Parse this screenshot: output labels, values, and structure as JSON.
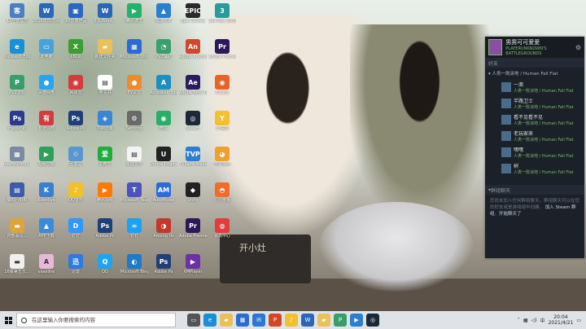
{
  "desktop_icons": [
    {
      "label": "13号管理员",
      "color": "#4c7fc1",
      "glyph": "客"
    },
    {
      "label": "Microsoft Edge",
      "color": "#1b8fd6",
      "glyph": "e"
    },
    {
      "label": "PVZ游戏",
      "color": "#3a9e6a",
      "glyph": "P"
    },
    {
      "label": "magic_in",
      "color": "#2b3a8f",
      "glyph": "Ps"
    },
    {
      "label": "img_d9f4f8...jpg",
      "color": "#7a8aa0",
      "glyph": "▦"
    },
    {
      "label": "编织行5(8)",
      "color": "#3e5aa8",
      "glyph": "▤"
    },
    {
      "label": "内部会议...",
      "color": "#d9a53c",
      "glyph": "▬"
    },
    {
      "label": "16级第五次...",
      "color": "#f0f0f0",
      "glyph": "▬"
    },
    {
      "label": "2018年日记.docx",
      "color": "#2b66b8",
      "glyph": "W"
    },
    {
      "label": "此电脑",
      "color": "#4aa0d9",
      "glyph": "▭"
    },
    {
      "label": "百度网盘",
      "color": "#2ba3f3",
      "glyph": "●"
    },
    {
      "label": "有道词典",
      "color": "#d23c3c",
      "glyph": "有"
    },
    {
      "label": "视频剪辑",
      "color": "#2ea05a",
      "glyph": "▶"
    },
    {
      "label": "Kdenlive",
      "color": "#3a7fd0",
      "glyph": "K"
    },
    {
      "label": "APP下载",
      "color": "#3b8bd8",
      "glyph": "▲"
    },
    {
      "label": "vaseline",
      "color": "#e7b9d8",
      "glyph": "A"
    },
    {
      "label": "3D创意作品",
      "color": "#2a67c0",
      "glyph": "▣"
    },
    {
      "label": "XBOX",
      "color": "#3e9c35",
      "glyph": "X"
    },
    {
      "label": "网易云",
      "color": "#d93a3a",
      "glyph": "◉"
    },
    {
      "label": "Adobe Ps",
      "color": "#1e3f78",
      "glyph": "Ps"
    },
    {
      "label": "回收站",
      "color": "#5a96d2",
      "glyph": "♲"
    },
    {
      "label": "QQ音乐",
      "color": "#f2c02b",
      "glyph": "♪"
    },
    {
      "label": "钉钉",
      "color": "#3296fa",
      "glyph": "D"
    },
    {
      "label": "迅雷",
      "color": "#2d7ae5",
      "glyph": "迅"
    },
    {
      "label": "1.1.Word...",
      "color": "#2b66b8",
      "glyph": "W"
    },
    {
      "label": "新建文件夹",
      "color": "#e8c15a",
      "glyph": "▰"
    },
    {
      "label": "电子书",
      "color": "#ffffff",
      "glyph": "▤"
    },
    {
      "label": "控制面板",
      "color": "#3a86d2",
      "glyph": "◈"
    },
    {
      "label": "爱奇艺",
      "color": "#1fae3c",
      "glyph": "爱"
    },
    {
      "label": "腾讯视频",
      "color": "#ff7a00",
      "glyph": "▶"
    },
    {
      "label": "Adobe Ps",
      "color": "#1e3f78",
      "glyph": "Ps"
    },
    {
      "label": "QQ",
      "color": "#1fa4f0",
      "glyph": "Q"
    },
    {
      "label": "腾讯课堂",
      "color": "#23b26d",
      "glyph": "▶"
    },
    {
      "label": "Microsoft Store",
      "color": "#2b6cd4",
      "glyph": "▦"
    },
    {
      "label": "EV录屏",
      "color": "#f08a2c",
      "glyph": "●"
    },
    {
      "label": "Settings",
      "color": "#6a6a6a",
      "glyph": "⚙"
    },
    {
      "label": "桌面文件",
      "color": "#f4f4f4",
      "glyph": "▤"
    },
    {
      "label": "Microsoft Teams",
      "color": "#4b53bc",
      "glyph": "T"
    },
    {
      "label": "钉钉",
      "color": "#1da1f2",
      "glyph": "∞"
    },
    {
      "label": "Microsoft Bing",
      "color": "#1d7ac9",
      "glyph": "◐"
    },
    {
      "label": "极速PDF",
      "color": "#2a7fd2",
      "glyph": "▲"
    },
    {
      "label": "PVZ辅助",
      "color": "#3aa06a",
      "glyph": "◔"
    },
    {
      "label": "Autodesk 3ds Max",
      "color": "#1b8fc0",
      "glyph": "A"
    },
    {
      "label": "微信",
      "color": "#2aae67",
      "glyph": "◉"
    },
    {
      "label": "Unreal Engine",
      "color": "#222222",
      "glyph": "U"
    },
    {
      "label": "AutoModel",
      "color": "#2d6bd8",
      "glyph": "AM"
    },
    {
      "label": "Among Us",
      "color": "#c0392b",
      "glyph": "◑"
    },
    {
      "label": "Adobe Ps",
      "color": "#1e3f78",
      "glyph": "Ps"
    },
    {
      "label": "Epic Games",
      "color": "#2a2a2a",
      "glyph": "EPIC"
    },
    {
      "label": "Adobe Animate",
      "color": "#d1462f",
      "glyph": "An"
    },
    {
      "label": "Adobe After Effects",
      "color": "#2a1b5e",
      "glyph": "Ae"
    },
    {
      "label": "Steam",
      "color": "#1b2838",
      "glyph": "◎"
    },
    {
      "label": "TVPaint Animation",
      "color": "#2c7fd0",
      "glyph": "TVP"
    },
    {
      "label": "Unity",
      "color": "#222222",
      "glyph": "◆"
    },
    {
      "label": "Adobe Premiere",
      "color": "#2b1858",
      "glyph": "Pr"
    },
    {
      "label": "XMPlayer",
      "color": "#6b2fa8",
      "glyph": "▶"
    },
    {
      "label": "3ds Max 2016",
      "color": "#2a9a9a",
      "glyph": "3"
    },
    {
      "label": "Adobe Premiere Pro",
      "color": "#2b1858",
      "glyph": "Pr"
    },
    {
      "label": "Firefox",
      "color": "#e8632a",
      "glyph": "◉"
    },
    {
      "label": "YY语音",
      "color": "#f2c12e",
      "glyph": "Y"
    },
    {
      "label": "守护猫咪",
      "color": "#f0a030",
      "glyph": "◕"
    },
    {
      "label": "心灵画板",
      "color": "#f26b2a",
      "glyph": "◓"
    },
    {
      "label": "会员中心",
      "color": "#e23c3c",
      "glyph": "◍"
    }
  ],
  "steam": {
    "username": "男男可可爱爱",
    "status": "PLAYERUNKNOWN'S BATTLEGROUNDS",
    "friends_label": "好友",
    "group_label": "人类一败涂地 / Human Fall Flat",
    "friends": [
      {
        "name": "一滴",
        "status": "人类一败涂地 / Human Fall Flat"
      },
      {
        "name": "半路卫士",
        "status": "人类一败涂地 / Human Fall Flat"
      },
      {
        "name": "看不见看不见",
        "status": "人类一败涂地 / Human Fall Flat"
      },
      {
        "name": "老玩家来",
        "status": "人类一败涂地 / Human Fall Flat"
      },
      {
        "name": "嘿嘿",
        "status": "人类一败涂地 / Human Fall Flat"
      },
      {
        "name": "树",
        "status": "人类一败涂地 / Human Fall Flat"
      }
    ],
    "chat_label": "群组聊天",
    "chat_text": "您尚未加入任何群组聊天。群组聊天可以在您的好友或是游戏组中创建。",
    "chat_link": "加入 Steam 群组",
    "chat_link2": "开始聊天了"
  },
  "taskbar": {
    "search_placeholder": "在这里输入你要搜索的内容",
    "time": "20:04",
    "date": "2021/4/21",
    "lang": "中",
    "apps": [
      {
        "name": "task-view",
        "color": "#555",
        "glyph": "▭"
      },
      {
        "name": "edge",
        "color": "#1b8fd6",
        "glyph": "e"
      },
      {
        "name": "explorer",
        "color": "#e8c15a",
        "glyph": "▰"
      },
      {
        "name": "store",
        "color": "#2b6cd4",
        "glyph": "▦"
      },
      {
        "name": "mail",
        "color": "#2b78d4",
        "glyph": "✉"
      },
      {
        "name": "ppt",
        "color": "#d24726",
        "glyph": "P"
      },
      {
        "name": "qq-music",
        "color": "#f2c02b",
        "glyph": "♪"
      },
      {
        "name": "word",
        "color": "#2b66b8",
        "glyph": "W"
      },
      {
        "name": "folder",
        "color": "#e8c15a",
        "glyph": "▰"
      },
      {
        "name": "pvz",
        "color": "#3a9e6a",
        "glyph": "P"
      },
      {
        "name": "tv",
        "color": "#2c7fd0",
        "glyph": "▶"
      },
      {
        "name": "steam",
        "color": "#1b2838",
        "glyph": "◎"
      }
    ]
  },
  "wallpaper_text": "开小灶"
}
